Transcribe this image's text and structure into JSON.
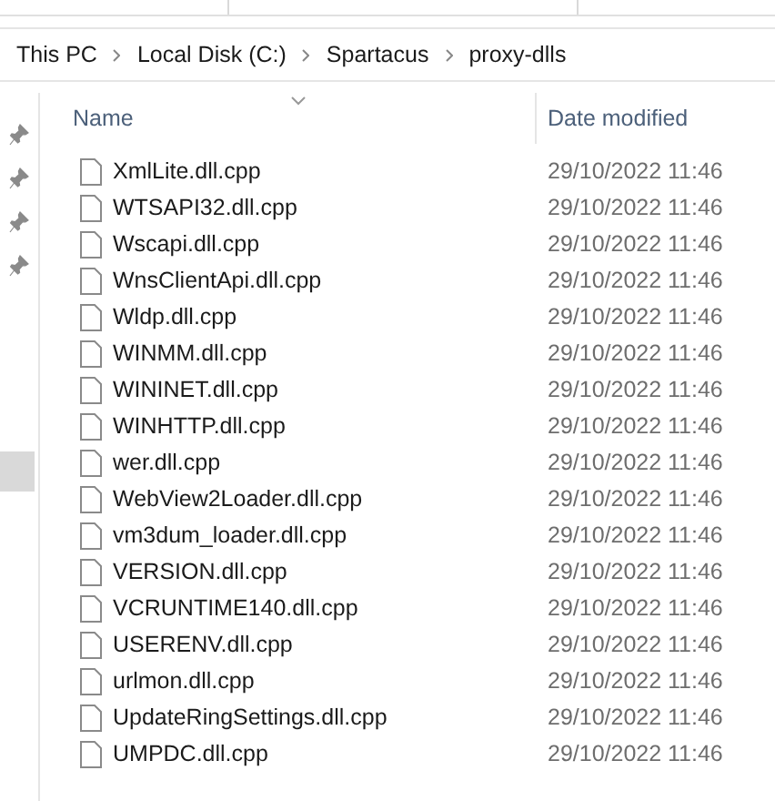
{
  "breadcrumb": [
    "This PC",
    "Local Disk (C:)",
    "Spartacus",
    "proxy-dlls"
  ],
  "columns": [
    {
      "label": "Name"
    },
    {
      "label": "Date modified"
    }
  ],
  "files": [
    {
      "name": "XmlLite.dll.cpp",
      "modified": "29/10/2022 11:46"
    },
    {
      "name": "WTSAPI32.dll.cpp",
      "modified": "29/10/2022 11:46"
    },
    {
      "name": "Wscapi.dll.cpp",
      "modified": "29/10/2022 11:46"
    },
    {
      "name": "WnsClientApi.dll.cpp",
      "modified": "29/10/2022 11:46"
    },
    {
      "name": "Wldp.dll.cpp",
      "modified": "29/10/2022 11:46"
    },
    {
      "name": "WINMM.dll.cpp",
      "modified": "29/10/2022 11:46"
    },
    {
      "name": "WININET.dll.cpp",
      "modified": "29/10/2022 11:46"
    },
    {
      "name": "WINHTTP.dll.cpp",
      "modified": "29/10/2022 11:46"
    },
    {
      "name": "wer.dll.cpp",
      "modified": "29/10/2022 11:46"
    },
    {
      "name": "WebView2Loader.dll.cpp",
      "modified": "29/10/2022 11:46"
    },
    {
      "name": "vm3dum_loader.dll.cpp",
      "modified": "29/10/2022 11:46"
    },
    {
      "name": "VERSION.dll.cpp",
      "modified": "29/10/2022 11:46"
    },
    {
      "name": "VCRUNTIME140.dll.cpp",
      "modified": "29/10/2022 11:46"
    },
    {
      "name": "USERENV.dll.cpp",
      "modified": "29/10/2022 11:46"
    },
    {
      "name": "urlmon.dll.cpp",
      "modified": "29/10/2022 11:46"
    },
    {
      "name": "UpdateRingSettings.dll.cpp",
      "modified": "29/10/2022 11:46"
    },
    {
      "name": "UMPDC.dll.cpp",
      "modified": "29/10/2022 11:46"
    }
  ]
}
